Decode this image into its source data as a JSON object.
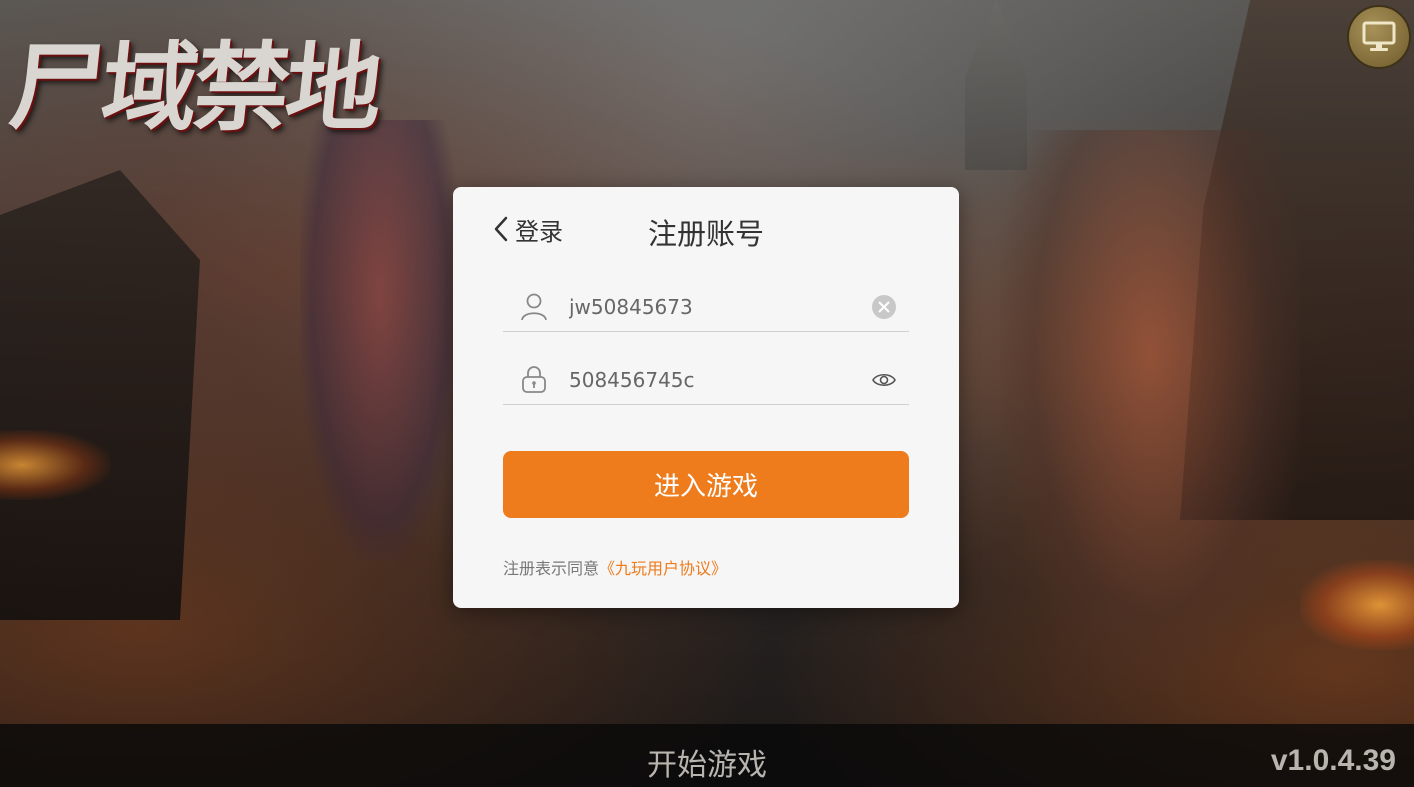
{
  "game": {
    "logo_text": "尸域禁地",
    "version": "v1.0.4.39"
  },
  "top_right": {
    "icon": "monitor-icon"
  },
  "dialog": {
    "title": "注册账号",
    "back_label": "登录",
    "username": {
      "value": "jw50845673",
      "icon": "user-icon",
      "clear_icon": "clear-icon"
    },
    "password": {
      "value": "508456745c",
      "icon": "lock-icon",
      "toggle_icon": "eye-icon"
    },
    "submit_label": "进入游戏",
    "agreement_prefix": "注册表示同意",
    "agreement_link": "《九玩用户协议》"
  },
  "bottom_bar": {
    "start_label": "开始游戏"
  },
  "colors": {
    "accent": "#ee7b1c",
    "dialog_bg": "#f6f6f6",
    "text_dark": "#333333",
    "text_muted": "#777777"
  }
}
